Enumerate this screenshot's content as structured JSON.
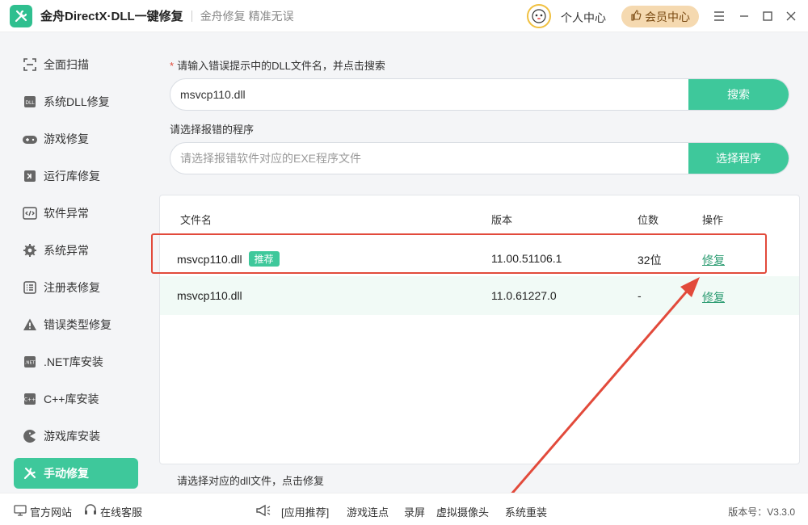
{
  "titlebar": {
    "app_title": "金舟DirectX·DLL一键修复",
    "slogan": "金舟修复 精准无误",
    "personal_center": "个人中心",
    "vip_center": "会员中心"
  },
  "sidebar": {
    "items": [
      {
        "label": "全面扫描",
        "icon": "scan-icon"
      },
      {
        "label": "系统DLL修复",
        "icon": "dll-icon"
      },
      {
        "label": "游戏修复",
        "icon": "gamepad-icon"
      },
      {
        "label": "运行库修复",
        "icon": "runtime-icon"
      },
      {
        "label": "软件异常",
        "icon": "code-icon"
      },
      {
        "label": "系统异常",
        "icon": "gear-icon"
      },
      {
        "label": "注册表修复",
        "icon": "list-icon"
      },
      {
        "label": "错误类型修复",
        "icon": "warning-icon"
      },
      {
        "label": ".NET库安装",
        "icon": "dotnet-icon"
      },
      {
        "label": "C++库安装",
        "icon": "cpp-icon"
      },
      {
        "label": "游戏库安装",
        "icon": "pacman-icon"
      },
      {
        "label": "手动修复",
        "icon": "wrench-icon",
        "active": true
      }
    ]
  },
  "search": {
    "required_mark": "*",
    "label": "请输入错误提示中的DLL文件名，并点击搜索",
    "value": "msvcp110.dll",
    "button": "搜索"
  },
  "program": {
    "label": "请选择报错的程序",
    "placeholder": "请选择报错软件对应的EXE程序文件",
    "button": "选择程序"
  },
  "results": {
    "headers": {
      "filename": "文件名",
      "version": "版本",
      "bits": "位数",
      "action": "操作"
    },
    "rows": [
      {
        "filename": "msvcp110.dll",
        "badge": "推荐",
        "version": "11.00.51106.1",
        "bits": "32位",
        "action": "修复"
      },
      {
        "filename": "msvcp110.dll",
        "badge": "",
        "version": "11.0.61227.0",
        "bits": "-",
        "action": "修复"
      }
    ],
    "hint": "请选择对应的dll文件，点击修复"
  },
  "footer": {
    "official_site": "官方网站",
    "online_service": "在线客服",
    "app_recommend": "[应用推荐]",
    "links": [
      "游戏连点",
      "录屏",
      "虚拟摄像头",
      "系统重装"
    ],
    "version": "版本号：V3.3.0"
  },
  "colors": {
    "accent": "#3ec89b",
    "annotation_red": "#e24a3b",
    "vip_bg": "#f5d9b0"
  }
}
